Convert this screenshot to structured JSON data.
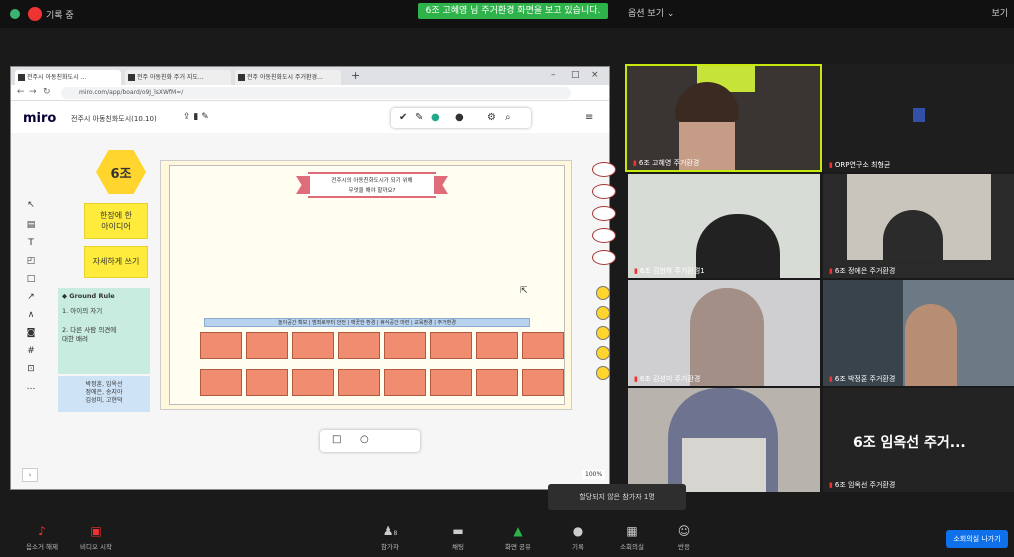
{
  "topbar": {
    "recording_label": "기록 중",
    "share_banner": "6조 고혜영 님 주거환경 화면을 보고 있습니다.",
    "view_options": "옵션 보기 ⌄",
    "view_label": "보기"
  },
  "browser": {
    "tabs": [
      "전주시 아동친화도시 ...",
      "전주 아동친화 주거 지도...",
      "전주 아동친화도시 주거환경..."
    ],
    "url": "miro.com/app/board/o9J_lsXWfM=/"
  },
  "miro": {
    "logo": "miro",
    "board_name": "전주시 아동친화도시(10.10)",
    "group_label": "6조",
    "sticky_1": "한장에 한\n아이디어",
    "sticky_2": "자세하게 쓰기",
    "ground_rule_title": "◆ Ground Rule",
    "ground_rule_1": "1. 아이의 자기",
    "ground_rule_2": "2. 다른 사람 의견에\n대한 배려",
    "names": "박정훈, 임옥선\n정에은, 송지아\n김성미, 고현덕",
    "banner_text": "전주시의 아동친화도시가 되기 위해\n무엇을 해야 할까요?",
    "category_row": "놀이공간 확보 | 범죄로부터 안전 | 깨끗한 환경 | 휴식공간 마련 | 교육환경 | 주거환경",
    "zoom": "100%"
  },
  "video": {
    "participants": [
      {
        "name": "6조 고혜영 주거환경",
        "speaking": true
      },
      {
        "name": "ORP연구소 최형균",
        "speaking": false
      },
      {
        "name": "6조 김현하 주거환경1",
        "speaking": false
      },
      {
        "name": "6조 정에은 주거환경",
        "speaking": false
      },
      {
        "name": "6조 김성미 주거환경",
        "speaking": false
      },
      {
        "name": "6조 박정훈 주거환경",
        "speaking": false
      },
      {
        "name": "",
        "speaking": false
      },
      {
        "name": "6조 임옥선 주거환경",
        "speaking": false
      }
    ],
    "big_name": "6조 임옥선 주거...",
    "toast": "할당되지 않은 참가자 1명"
  },
  "toolbar": {
    "items": [
      {
        "icon": "mic-muted",
        "label": "음소거 해제"
      },
      {
        "icon": "video-off",
        "label": "비디오 시작"
      },
      {
        "icon": "participants",
        "label": "참가자",
        "count": "8"
      },
      {
        "icon": "chat",
        "label": "채팅"
      },
      {
        "icon": "share",
        "label": "화면 공유"
      },
      {
        "icon": "record",
        "label": "기록"
      },
      {
        "icon": "breakout",
        "label": "소회의실"
      },
      {
        "icon": "reactions",
        "label": "반응"
      }
    ],
    "leave": "소회의실 나가기"
  }
}
